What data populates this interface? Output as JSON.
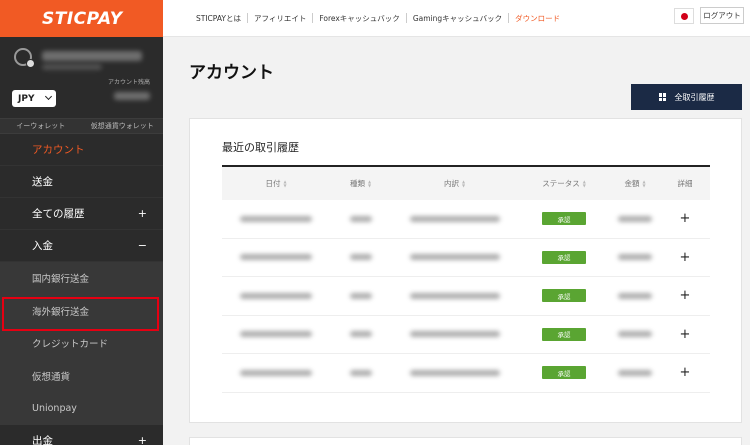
{
  "brand": {
    "logo": "STICPAY",
    "accent": "#f15a24",
    "sidebar_bg": "#2b2b2b"
  },
  "sidebar": {
    "currency": "JPY",
    "account_label": "アカウント残高",
    "wallet_tabs": [
      "イーウォレット",
      "仮想通貨ウォレット"
    ],
    "nav": [
      {
        "label": "アカウント",
        "sign": ""
      },
      {
        "label": "送金",
        "sign": ""
      },
      {
        "label": "全ての履歴",
        "sign": "+"
      },
      {
        "label": "入金",
        "sign": "−"
      }
    ],
    "sub": [
      "国内銀行送金",
      "海外銀行送金",
      "クレジットカード",
      "仮想通貨",
      "Unionpay"
    ],
    "bottom": {
      "label": "出金",
      "sign": "+"
    }
  },
  "topbar": {
    "links": [
      "STICPAYとは",
      "アフィリエイト",
      "Forexキャッシュバック",
      "Gamingキャッシュバック",
      "ダウンロード"
    ],
    "logout": "ログアウト"
  },
  "main": {
    "title": "アカウント",
    "history_button": "全取引履歴",
    "card_title": "最近の取引履歴",
    "columns": [
      "日付",
      "種類",
      "内訳",
      "ステータス",
      "金額",
      "詳細"
    ],
    "rows": [
      {
        "status": "承認"
      },
      {
        "status": "承認"
      },
      {
        "status": "承認"
      },
      {
        "status": "承認"
      },
      {
        "status": "承認"
      }
    ],
    "status_color": "#5aa532"
  }
}
